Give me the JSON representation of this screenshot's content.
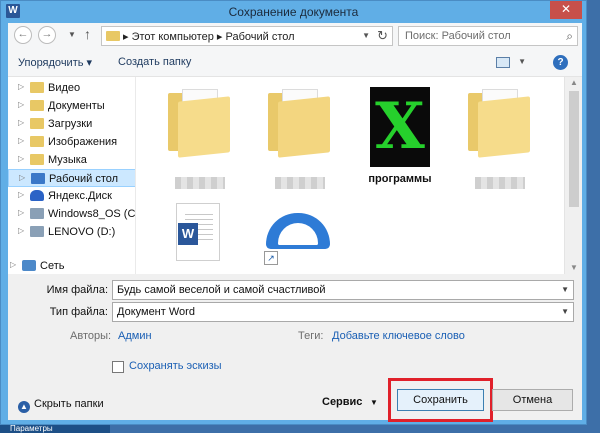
{
  "window": {
    "title": "Сохранение документа",
    "close_label": "✕"
  },
  "nav": {
    "breadcrumb": [
      "Этот компьютер",
      "Рабочий стол"
    ],
    "search_placeholder": "Поиск: Рабочий стол"
  },
  "toolbar": {
    "organize_label": "Упорядочить ▾",
    "new_folder_label": "Создать папку",
    "help_label": "?"
  },
  "sidebar": {
    "items": [
      {
        "label": "Видео",
        "icon": "folder"
      },
      {
        "label": "Документы",
        "icon": "folder"
      },
      {
        "label": "Загрузки",
        "icon": "folder"
      },
      {
        "label": "Изображения",
        "icon": "folder"
      },
      {
        "label": "Музыка",
        "icon": "folder"
      },
      {
        "label": "Рабочий стол",
        "icon": "folder",
        "selected": true
      },
      {
        "label": "Яндекс.Диск",
        "icon": "cloud"
      },
      {
        "label": "Windows8_OS (C",
        "icon": "disk"
      },
      {
        "label": "LENOVO (D:)",
        "icon": "disk"
      }
    ],
    "network_label": "Сеть"
  },
  "files": [
    {
      "kind": "folder",
      "label": ""
    },
    {
      "kind": "folder",
      "label": ""
    },
    {
      "kind": "x-logo",
      "label": "программы"
    },
    {
      "kind": "folder",
      "label": ""
    },
    {
      "kind": "word-doc",
      "label": ""
    },
    {
      "kind": "yandex-disk-shortcut",
      "label": ""
    }
  ],
  "form": {
    "filename_label": "Имя файла:",
    "filename_value": "Будь самой веселой и самой счастливой",
    "filetype_label": "Тип файла:",
    "filetype_value": "Документ Word",
    "authors_label": "Авторы:",
    "authors_value": "Админ",
    "tags_label": "Теги:",
    "tags_value": "Добавьте ключевое слово",
    "thumbnail_label": "Сохранять эскизы"
  },
  "footer": {
    "hide_folders_label": "Скрыть папки",
    "service_label": "Сервис",
    "save_label": "Сохранить",
    "cancel_label": "Отмена"
  },
  "taskbar": {
    "label": "Параметры"
  },
  "colors": {
    "frame": "#60aee6",
    "highlight": "#e0202a",
    "link": "#1a5fb4",
    "word": "#2b579a"
  }
}
